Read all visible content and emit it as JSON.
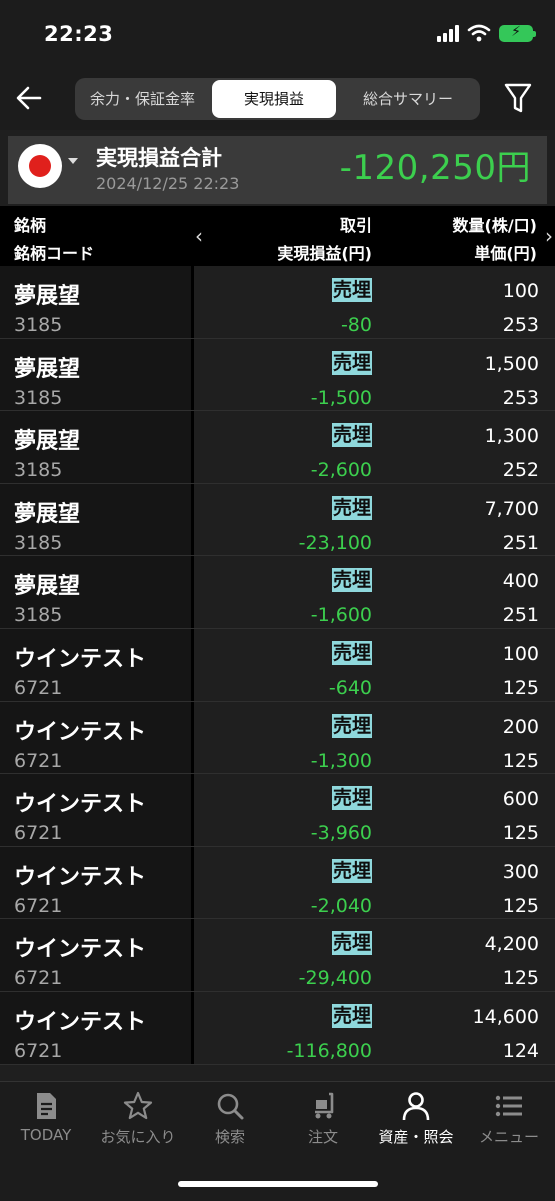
{
  "status": {
    "time": "22:23"
  },
  "header": {
    "tabs": [
      {
        "label": "余力・保証金率",
        "active": false
      },
      {
        "label": "実現損益",
        "active": true
      },
      {
        "label": "総合サマリー",
        "active": false
      }
    ]
  },
  "summary": {
    "title": "実現損益合計",
    "datetime": "2024/12/25 22:23",
    "value": "-120,250円"
  },
  "columns": {
    "name": "銘柄",
    "code": "銘柄コード",
    "trade": "取引",
    "pl": "実現損益(円)",
    "qty": "数量(株/口)",
    "price": "単価(円)"
  },
  "rows": [
    {
      "name": "夢展望",
      "code": "3185",
      "trade": "売埋",
      "pl": "-80",
      "qty": "100",
      "price": "253"
    },
    {
      "name": "夢展望",
      "code": "3185",
      "trade": "売埋",
      "pl": "-1,500",
      "qty": "1,500",
      "price": "253"
    },
    {
      "name": "夢展望",
      "code": "3185",
      "trade": "売埋",
      "pl": "-2,600",
      "qty": "1,300",
      "price": "252"
    },
    {
      "name": "夢展望",
      "code": "3185",
      "trade": "売埋",
      "pl": "-23,100",
      "qty": "7,700",
      "price": "251"
    },
    {
      "name": "夢展望",
      "code": "3185",
      "trade": "売埋",
      "pl": "-1,600",
      "qty": "400",
      "price": "251"
    },
    {
      "name": "ウインテスト",
      "code": "6721",
      "trade": "売埋",
      "pl": "-640",
      "qty": "100",
      "price": "125"
    },
    {
      "name": "ウインテスト",
      "code": "6721",
      "trade": "売埋",
      "pl": "-1,300",
      "qty": "200",
      "price": "125"
    },
    {
      "name": "ウインテスト",
      "code": "6721",
      "trade": "売埋",
      "pl": "-3,960",
      "qty": "600",
      "price": "125"
    },
    {
      "name": "ウインテスト",
      "code": "6721",
      "trade": "売埋",
      "pl": "-2,040",
      "qty": "300",
      "price": "125"
    },
    {
      "name": "ウインテスト",
      "code": "6721",
      "trade": "売埋",
      "pl": "-29,400",
      "qty": "4,200",
      "price": "125"
    },
    {
      "name": "ウインテスト",
      "code": "6721",
      "trade": "売埋",
      "pl": "-116,800",
      "qty": "14,600",
      "price": "124"
    }
  ],
  "tabbar": [
    {
      "label": "TODAY",
      "icon": "today-icon",
      "active": false
    },
    {
      "label": "お気に入り",
      "icon": "star-icon",
      "active": false
    },
    {
      "label": "検索",
      "icon": "search-icon",
      "active": false
    },
    {
      "label": "注文",
      "icon": "cart-icon",
      "active": false
    },
    {
      "label": "資産・照会",
      "icon": "person-icon",
      "active": true
    },
    {
      "label": "メニュー",
      "icon": "menu-icon",
      "active": false
    }
  ],
  "colors": {
    "accent_green": "#3ccf4e",
    "trade_badge": "#8fd8dc",
    "flag_red": "#e0201c"
  }
}
